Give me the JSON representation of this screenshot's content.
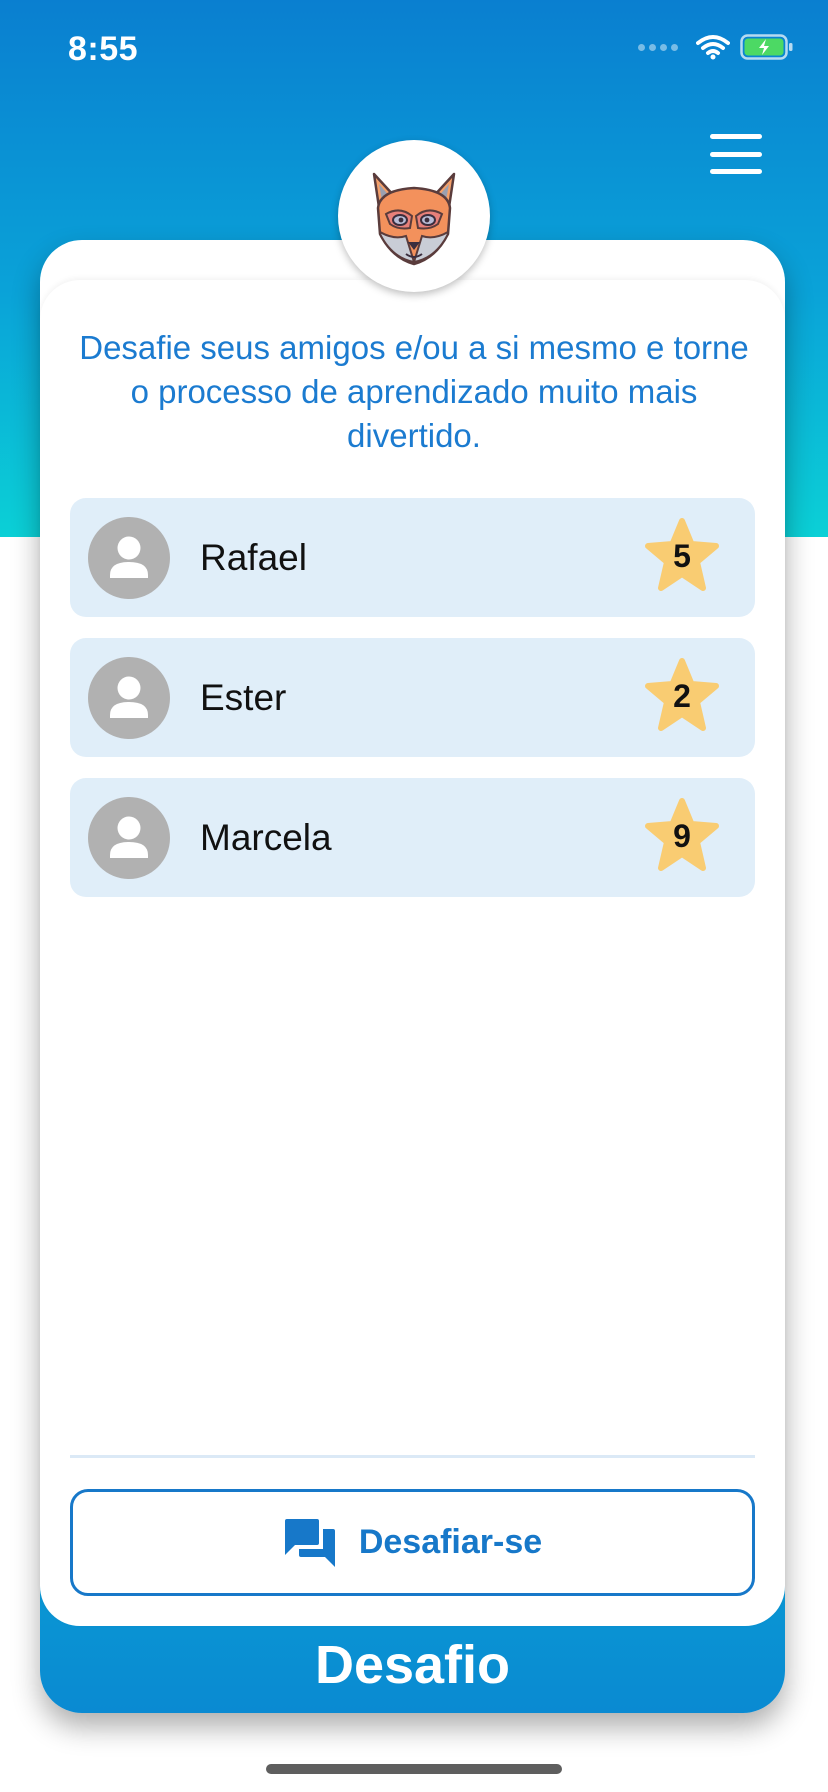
{
  "status_bar": {
    "time": "8:55"
  },
  "header": {
    "menu_icon": "hamburger-menu-icon",
    "mascot_icon": "fox-mascot-icon"
  },
  "intro": {
    "text": "Desafie seus amigos e/ou a si mesmo e torne o processo de aprendizado muito mais divertido."
  },
  "friends": [
    {
      "name": "Rafael",
      "score": "5"
    },
    {
      "name": "Ester",
      "score": "2"
    },
    {
      "name": "Marcela",
      "score": "9"
    }
  ],
  "challenge_button": {
    "label": "Desafiar-se",
    "icon": "chat-bubbles-icon"
  },
  "footer": {
    "title": "Desafio"
  },
  "colors": {
    "accent": "#1778c9",
    "hero_top": "#0a7fd0",
    "hero_bottom": "#0bd0d6",
    "row_bg": "#e0eef9",
    "star": "#f9cc72"
  }
}
